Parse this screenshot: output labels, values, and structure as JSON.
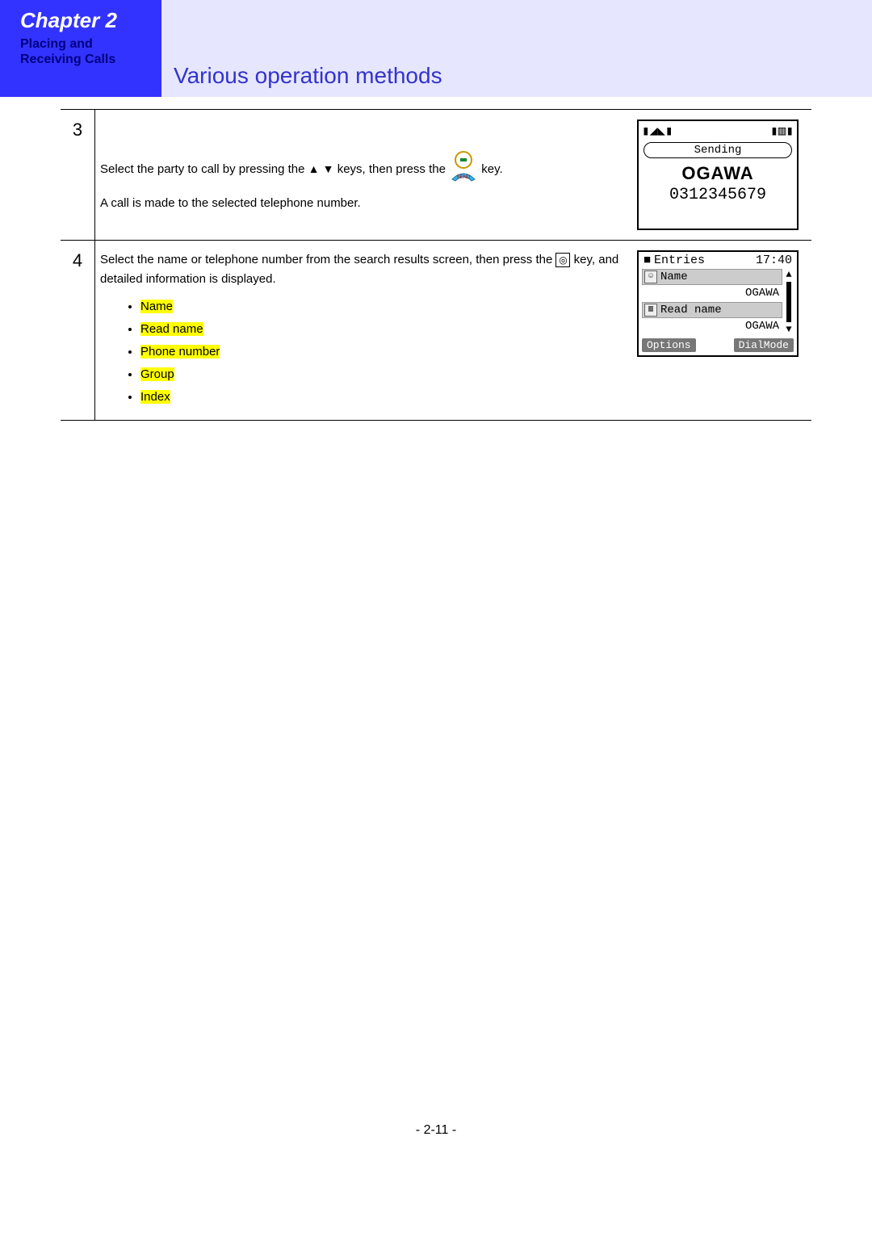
{
  "header": {
    "chapter": "Chapter 2",
    "chapter_sub": "Placing and Receiving Calls",
    "section": "Various operation methods"
  },
  "steps": {
    "s3": {
      "num": "3",
      "text_a": "Select the party to call by pressing the ",
      "text_b": " keys, then press the ",
      "text_c": " key.",
      "text_d": "A call is made to the selected telephone number."
    },
    "s4": {
      "num": "4",
      "text_a": "Select the name or telephone number from the search results screen, then press the ",
      "text_b": " key, and detailed information is displayed.",
      "bullets": [
        "Name",
        "Read name",
        "Phone number",
        "Group",
        "Index"
      ]
    }
  },
  "phone1": {
    "status": "Sending",
    "name": "OGAWA",
    "number": "0312345679"
  },
  "phone2": {
    "title": "Entries",
    "time": "17:40",
    "row1_label": "Name",
    "row1_value": "OGAWA",
    "row2_label": "Read name",
    "row2_value": "OGAWA",
    "soft_left": "Options",
    "soft_right": "DialMode"
  },
  "footer": {
    "page": "- 2-11 -"
  }
}
